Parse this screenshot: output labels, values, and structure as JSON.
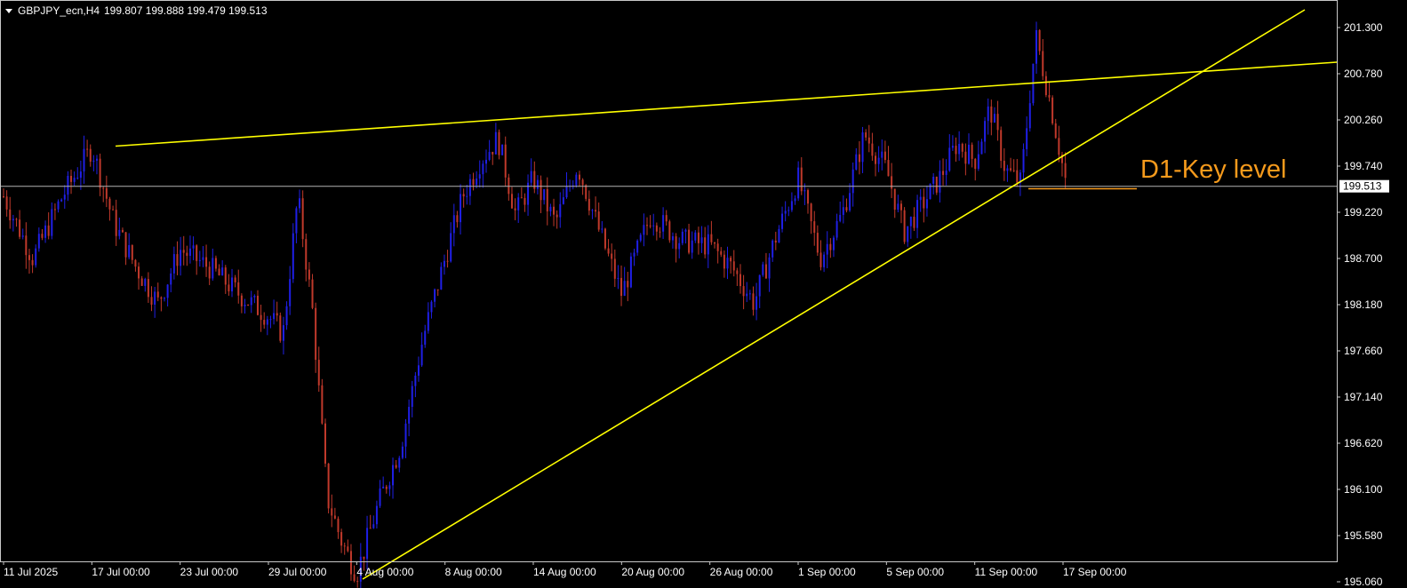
{
  "header": {
    "symbol": "GBPJPY_ecn,H4",
    "ohlc": "199.807 199.888 199.479 199.513"
  },
  "chart_data": {
    "type": "candlestick",
    "symbol": "GBPJPY_ecn",
    "timeframe": "H4",
    "ylim": [
      194.9,
      201.55
    ],
    "y_ticks": [
      "201.300",
      "200.780",
      "200.260",
      "199.740",
      "199.220",
      "198.700",
      "198.180",
      "197.660",
      "197.140",
      "196.620",
      "196.100",
      "195.580",
      "195.060"
    ],
    "x_ticks": [
      "11 Jul 2025",
      "17 Jul 00:00",
      "23 Jul 00:00",
      "29 Jul 00:00",
      "4 Aug 00:00",
      "8 Aug 00:00",
      "14 Aug 00:00",
      "20 Aug 00:00",
      "26 Aug 00:00",
      "1 Sep 00:00",
      "5 Sep 00:00",
      "11 Sep 00:00",
      "17 Sep 00:00"
    ],
    "current_price": "199.513",
    "colors": {
      "up": "#1f1fe6",
      "down": "#c0392b",
      "trendline": "#ffff00",
      "key_level": "#f59a1c",
      "current_line": "#b4b4b4"
    },
    "price_path": [
      [
        "11 Jul 2025",
        199.4
      ],
      [
        "13 Jul",
        198.7
      ],
      [
        "15 Jul",
        199.4
      ],
      [
        "17 Jul 00:00",
        199.95
      ],
      [
        "18 Jul",
        199.1
      ],
      [
        "21 Jul",
        198.6
      ],
      [
        "22 Jul",
        198.2
      ],
      [
        "23 Jul 00:00",
        198.8
      ],
      [
        "25 Jul",
        198.6
      ],
      [
        "27 Jul",
        198.3
      ],
      [
        "29 Jul 00:00",
        198.05
      ],
      [
        "30 Jul",
        197.85
      ],
      [
        "31 Jul",
        199.4
      ],
      [
        "1 Aug",
        198.1
      ],
      [
        "2 Aug",
        196.0
      ],
      [
        "3 Aug",
        195.5
      ],
      [
        "4 Aug 00:00",
        195.15
      ],
      [
        "5 Aug",
        195.95
      ],
      [
        "6 Aug",
        196.6
      ],
      [
        "7 Aug",
        197.8
      ],
      [
        "8 Aug 00:00",
        198.7
      ],
      [
        "9 Aug",
        199.4
      ],
      [
        "11 Aug",
        199.8
      ],
      [
        "12 Aug",
        200.05
      ],
      [
        "13 Aug",
        199.2
      ],
      [
        "14 Aug 00:00",
        199.6
      ],
      [
        "16 Aug",
        199.1
      ],
      [
        "18 Aug",
        199.75
      ],
      [
        "19 Aug",
        199.0
      ],
      [
        "20 Aug 00:00",
        198.3
      ],
      [
        "22 Aug",
        199.2
      ],
      [
        "24 Aug",
        198.9
      ],
      [
        "26 Aug 00:00",
        198.85
      ],
      [
        "28 Aug",
        198.6
      ],
      [
        "30 Aug",
        198.2
      ],
      [
        "31 Aug",
        198.95
      ],
      [
        "1 Sep 00:00",
        199.6
      ],
      [
        "2 Sep",
        198.7
      ],
      [
        "3 Sep",
        199.2
      ],
      [
        "4 Sep",
        200.1
      ],
      [
        "5 Sep 00:00",
        199.7
      ],
      [
        "7 Sep",
        199.0
      ],
      [
        "8 Sep",
        199.3
      ],
      [
        "9 Sep",
        199.6
      ],
      [
        "10 Sep",
        200.0
      ],
      [
        "11 Sep 00:00",
        199.8
      ],
      [
        "12 Sep",
        200.4
      ],
      [
        "14 Sep",
        199.7
      ],
      [
        "15 Sep",
        199.55
      ],
      [
        "16 Sep",
        201.2
      ],
      [
        "17 Sep",
        200.4
      ],
      [
        "17 Sep 00:00",
        199.51
      ]
    ],
    "trendlines": [
      {
        "from": [
          "17 Jul 00:00",
          199.965
        ],
        "to": [
          "right edge",
          200.91
        ]
      },
      {
        "from": [
          "4 Aug 00:00",
          195.09
        ],
        "to": [
          "right edge",
          201.5
        ]
      }
    ],
    "key_level": {
      "label": "D1-Key level",
      "price": 199.485
    }
  }
}
